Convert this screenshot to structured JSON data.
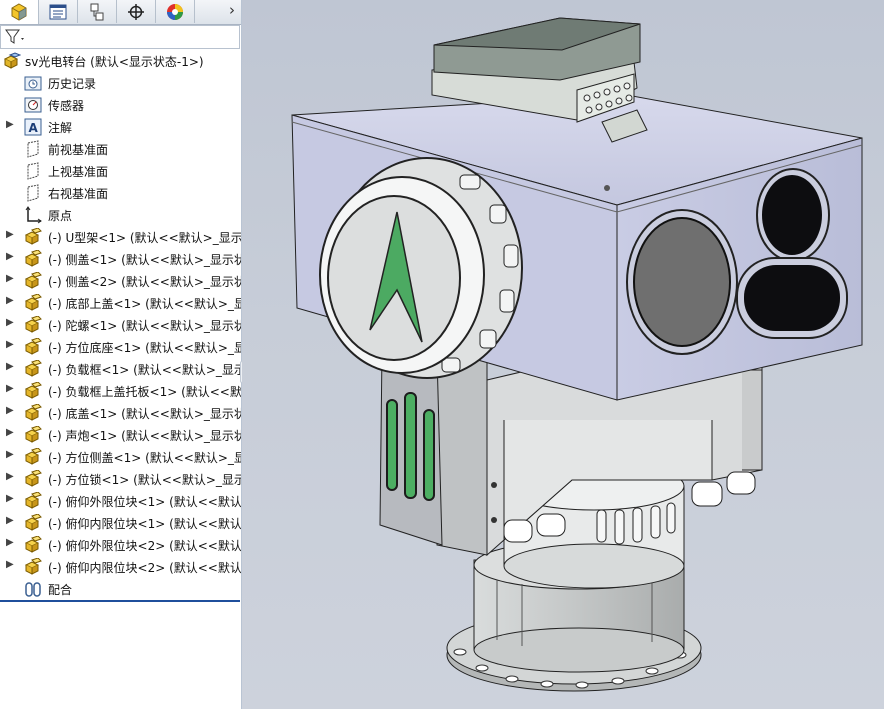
{
  "feature_tree": {
    "tabs": [
      {
        "name": "featuremanager-tab",
        "icon": "part-cube-icon"
      },
      {
        "name": "propertymanager-tab",
        "icon": "property-list-icon"
      },
      {
        "name": "configuration-tab",
        "icon": "configuration-icon"
      },
      {
        "name": "dimxpert-tab",
        "icon": "crosshair-icon"
      },
      {
        "name": "display-manager-tab",
        "icon": "color-wheel-icon"
      }
    ],
    "more_tabs_glyph": "›",
    "filter_icon": "funnel-filter-icon",
    "root": {
      "label": "sv光电转台  (默认<显示状态-1>)",
      "icon": "assembly-icon"
    },
    "items": [
      {
        "label": "历史记录",
        "icon": "history-folder-icon",
        "expandable": false
      },
      {
        "label": "传感器",
        "icon": "sensor-icon",
        "expandable": false
      },
      {
        "label": "注解",
        "icon": "annotation-icon",
        "expandable": true
      },
      {
        "label": "前视基准面",
        "icon": "plane-icon",
        "expandable": false
      },
      {
        "label": "上视基准面",
        "icon": "plane-icon",
        "expandable": false
      },
      {
        "label": "右视基准面",
        "icon": "plane-icon",
        "expandable": false
      },
      {
        "label": "原点",
        "icon": "origin-icon",
        "expandable": false
      },
      {
        "label": "(-) U型架<1> (默认<<默认>_显示状",
        "icon": "part-icon",
        "expandable": true
      },
      {
        "label": "(-) 侧盖<1> (默认<<默认>_显示状",
        "icon": "part-icon",
        "expandable": true
      },
      {
        "label": "(-) 侧盖<2> (默认<<默认>_显示状",
        "icon": "part-icon",
        "expandable": true
      },
      {
        "label": "(-) 底部上盖<1> (默认<<默认>_显示",
        "icon": "part-icon",
        "expandable": true
      },
      {
        "label": "(-) 陀螺<1> (默认<<默认>_显示状",
        "icon": "part-icon",
        "expandable": true
      },
      {
        "label": "(-) 方位底座<1> (默认<<默认>_显",
        "icon": "part-icon",
        "expandable": true
      },
      {
        "label": "(-) 负载框<1> (默认<<默认>_显示",
        "icon": "part-icon",
        "expandable": true
      },
      {
        "label": "(-) 负载框上盖托板<1> (默认<<默认",
        "icon": "part-icon",
        "expandable": true
      },
      {
        "label": "(-) 底盖<1> (默认<<默认>_显示状",
        "icon": "part-icon",
        "expandable": true
      },
      {
        "label": "(-) 声炮<1> (默认<<默认>_显示状",
        "icon": "part-icon",
        "expandable": true
      },
      {
        "label": "(-) 方位侧盖<1> (默认<<默认>_显",
        "icon": "part-icon",
        "expandable": true
      },
      {
        "label": "(-) 方位锁<1> (默认<<默认>_显示",
        "icon": "part-icon",
        "expandable": true
      },
      {
        "label": "(-) 俯仰外限位块<1> (默认<<默认>",
        "icon": "part-icon",
        "expandable": true
      },
      {
        "label": "(-) 俯仰内限位块<1> (默认<<默认>",
        "icon": "part-icon",
        "expandable": true
      },
      {
        "label": "(-) 俯仰外限位块<2> (默认<<默认>",
        "icon": "part-icon",
        "expandable": true
      },
      {
        "label": "(-) 俯仰内限位块<2> (默认<<默认>",
        "icon": "part-icon",
        "expandable": true
      },
      {
        "label": "配合",
        "icon": "mates-icon",
        "expandable": false
      }
    ]
  },
  "viewport": {
    "background_top": "#bfc6d3",
    "background_bottom": "#cdd2dc",
    "model_body_color": "#c8cbe3",
    "logo_color": "#4caa62",
    "window_color": "#707070",
    "lens_color": "#0d0d10"
  }
}
